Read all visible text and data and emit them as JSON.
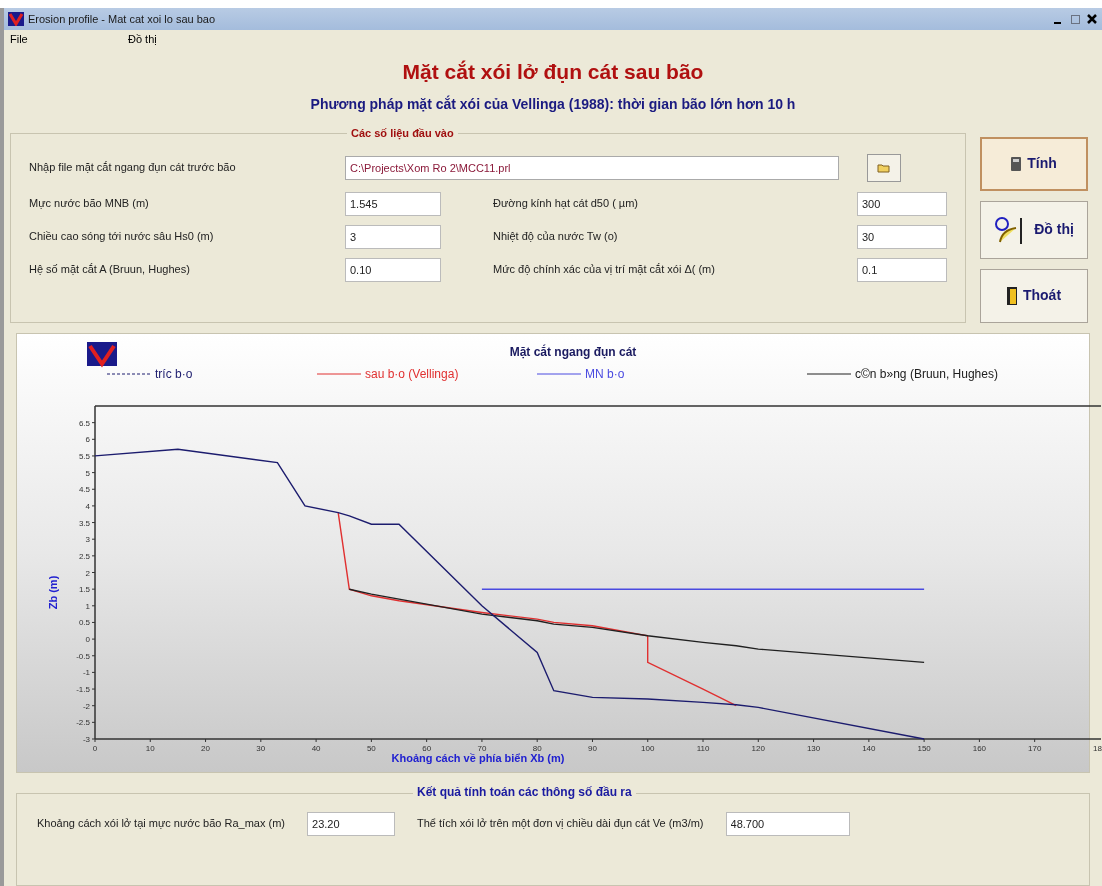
{
  "window": {
    "title": "Erosion profile - Mat cat xoi lo sau bao"
  },
  "menu": [
    "File",
    "Đồ thị"
  ],
  "heading": "Mặt cắt xói lở đụn cát sau bão",
  "subheading": "Phương pháp mặt cắt xói của Vellinga (1988): thời gian bão lớn hơn 10 h",
  "inputs": {
    "title": "Các số liệu đầu vào",
    "file": {
      "label": "Nhập file mặt cắt ngang đụn cát trước bão",
      "value": "C:\\Projects\\Xom Ro 2\\MCC11.prl"
    },
    "fields": [
      {
        "label": "Mực nước bão MNB (m)",
        "value": "1.545"
      },
      {
        "label": "Đường kính hạt cát d50 ( µm)",
        "value": "300"
      },
      {
        "label": "Chiều cao sóng tới nước sâu Hs0 (m)",
        "value": "3"
      },
      {
        "label": "Nhiệt độ của nước Tw (o)",
        "value": "30"
      },
      {
        "label": "Hệ số mặt cắt A (Bruun, Hughes)",
        "value": "0.10"
      },
      {
        "label": "Mức độ chính xác của vị trí mặt cắt xói   Δ( (m)",
        "value": "0.1"
      }
    ]
  },
  "buttons": [
    {
      "kind": "calc",
      "label": "Tính"
    },
    {
      "kind": "chart",
      "label": "Đồ thị"
    },
    {
      "kind": "exit",
      "label": "Thoát"
    }
  ],
  "chart": {
    "chart_data": {
      "type": "line",
      "title": "Mặt cắt ngang đụn cát",
      "xlabel": "Khoảng cách về phía biển Xb (m)",
      "ylabel": "Zb (m)",
      "x": [
        0,
        15,
        33,
        38,
        44,
        46,
        50,
        55,
        70,
        80,
        83,
        90,
        100,
        100,
        110,
        116,
        120,
        150
      ],
      "series": [
        {
          "name": "tríc b·o",
          "color": "#1c1c6e",
          "values": [
            5.5,
            5.7,
            5.3,
            4.0,
            3.8,
            3.7,
            3.45,
            3.45,
            1.0,
            -0.4,
            -1.55,
            -1.75,
            -1.8,
            -1.8,
            -1.9,
            -1.97,
            -2.05,
            -3.0
          ]
        },
        {
          "name": "sau b·o (Vellinga)",
          "color": "#e03030",
          "values": [
            null,
            null,
            null,
            null,
            3.8,
            1.5,
            1.3,
            1.15,
            0.8,
            0.6,
            0.5,
            0.4,
            0.1,
            -0.7,
            -1.5,
            -2.0,
            null,
            null
          ]
        },
        {
          "name": "MN b·o",
          "color": "#4a4ae0",
          "values": [
            null,
            null,
            null,
            null,
            null,
            null,
            null,
            null,
            1.5,
            1.5,
            1.5,
            1.5,
            1.5,
            1.5,
            1.5,
            1.5,
            1.5,
            1.5
          ]
        },
        {
          "name": "c©n b»ng (Bruun, Hughes)",
          "color": "#202020",
          "values": [
            null,
            null,
            null,
            null,
            null,
            1.5,
            1.35,
            1.2,
            0.75,
            0.55,
            0.45,
            0.35,
            0.1,
            0.1,
            -0.1,
            -0.2,
            -0.3,
            -0.7
          ]
        }
      ],
      "legend": "top",
      "xlim": [
        0,
        182
      ],
      "ylim": [
        -3,
        7
      ],
      "xticks": [
        0,
        10,
        20,
        30,
        40,
        50,
        60,
        70,
        80,
        90,
        100,
        110,
        120,
        130,
        140,
        150,
        160,
        170
      ],
      "yticks": [
        -3,
        -2.5,
        -2,
        -1.5,
        -1,
        -0.5,
        0,
        0.5,
        1,
        1.5,
        2,
        2.5,
        3,
        3.5,
        4,
        4.5,
        5,
        5.5,
        6,
        6.5
      ]
    },
    "legend_swatches": [
      {
        "kind": "dashed"
      },
      {
        "kind": "solid"
      },
      {
        "kind": "solid"
      },
      {
        "kind": "solid"
      }
    ],
    "edge_tick_label": "18"
  },
  "results": {
    "title": "Kết quả tính toán các thông số đầu ra",
    "fields": [
      {
        "label": "Khoảng cách xói lở tại mực nước bão Ra_max (m)",
        "value": "23.20"
      },
      {
        "label": "Thể tích xói lở trên một đơn vị chiều dài đụn cát Ve (m3/m)",
        "value": "48.700"
      }
    ]
  }
}
